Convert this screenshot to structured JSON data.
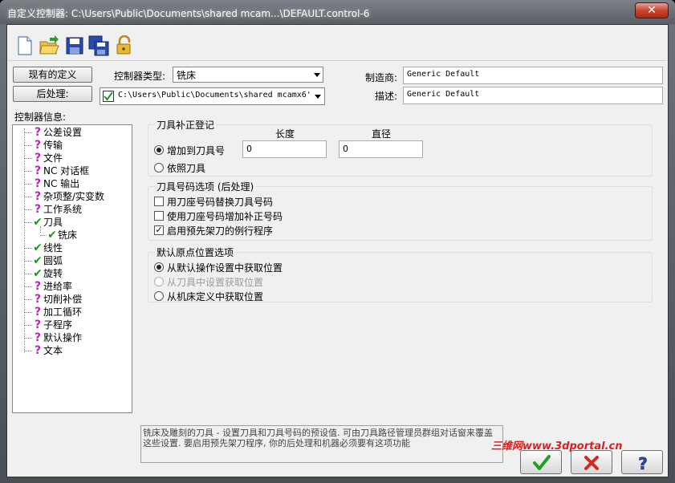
{
  "window": {
    "title": "自定义控制器: C:\\Users\\Public\\Documents\\shared mcam...\\DEFAULT.control-6",
    "close_label": "✕"
  },
  "toolbar": {
    "icons": [
      "new-file-icon",
      "open-folder-icon",
      "save-icon",
      "save-as-icon",
      "lock-icon"
    ]
  },
  "top": {
    "existing_def_button": "现有的定义",
    "post_button": "后处理:",
    "controller_type_label": "控制器类型:",
    "controller_type_value": "铣床",
    "post_path_value": "C:\\Users\\Public\\Documents\\shared mcamx6'",
    "manufacturer_label": "制造商:",
    "manufacturer_value": "Generic Default",
    "description_label": "描述:",
    "description_value": "Generic Default"
  },
  "tree": {
    "heading": "控制器信息:",
    "items": [
      {
        "label": "公差设置",
        "icon": "question-icon"
      },
      {
        "label": "传输",
        "icon": "question-icon"
      },
      {
        "label": "文件",
        "icon": "question-icon"
      },
      {
        "label": "NC 对话框",
        "icon": "question-icon"
      },
      {
        "label": "NC 输出",
        "icon": "question-icon"
      },
      {
        "label": "杂项整/实变数",
        "icon": "question-icon"
      },
      {
        "label": "工作系统",
        "icon": "question-icon"
      },
      {
        "label": "刀具",
        "icon": "check-icon"
      },
      {
        "label": "铣床",
        "icon": "check-icon"
      },
      {
        "label": "线性",
        "icon": "check-icon"
      },
      {
        "label": "圆弧",
        "icon": "check-icon"
      },
      {
        "label": "旋转",
        "icon": "check-icon"
      },
      {
        "label": "进给率",
        "icon": "question-icon"
      },
      {
        "label": "切削补偿",
        "icon": "question-icon"
      },
      {
        "label": "加工循环",
        "icon": "question-icon"
      },
      {
        "label": "子程序",
        "icon": "question-icon"
      },
      {
        "label": "默认操作",
        "icon": "question-icon"
      },
      {
        "label": "文本",
        "icon": "question-icon"
      }
    ]
  },
  "tool_comp": {
    "title": "刀具补正登记",
    "length_header": "长度",
    "diameter_header": "直径",
    "add_to_tool_label": "增加到刀具号",
    "length_value": "0",
    "diameter_value": "0",
    "by_tool_label": "依照刀具"
  },
  "tool_number": {
    "title": "刀具号码选项 (后处理)",
    "opt1": "用刀座号码替换刀具号码",
    "opt2": "使用刀座号码增加补正号码",
    "opt3": "启用预先架刀的例行程序"
  },
  "home_pos": {
    "title": "默认原点位置选项",
    "opt1": "从默认操作设置中获取位置",
    "opt2": "从刀具中设置获取位置",
    "opt3": "从机床定义中获取位置"
  },
  "hint": {
    "text": "铣床及雕刻的刀具 - 设置刀具和刀具号码的预设值. 可由刀具路径管理员群组对话窗来覆盖这些设置. 要启用预先架刀程序, 你的后处理和机器必须要有这项功能"
  },
  "buttons": {
    "ok": "✔",
    "cancel": "✖",
    "help": "?"
  },
  "watermark": "三维网www.3dportal.cn"
}
